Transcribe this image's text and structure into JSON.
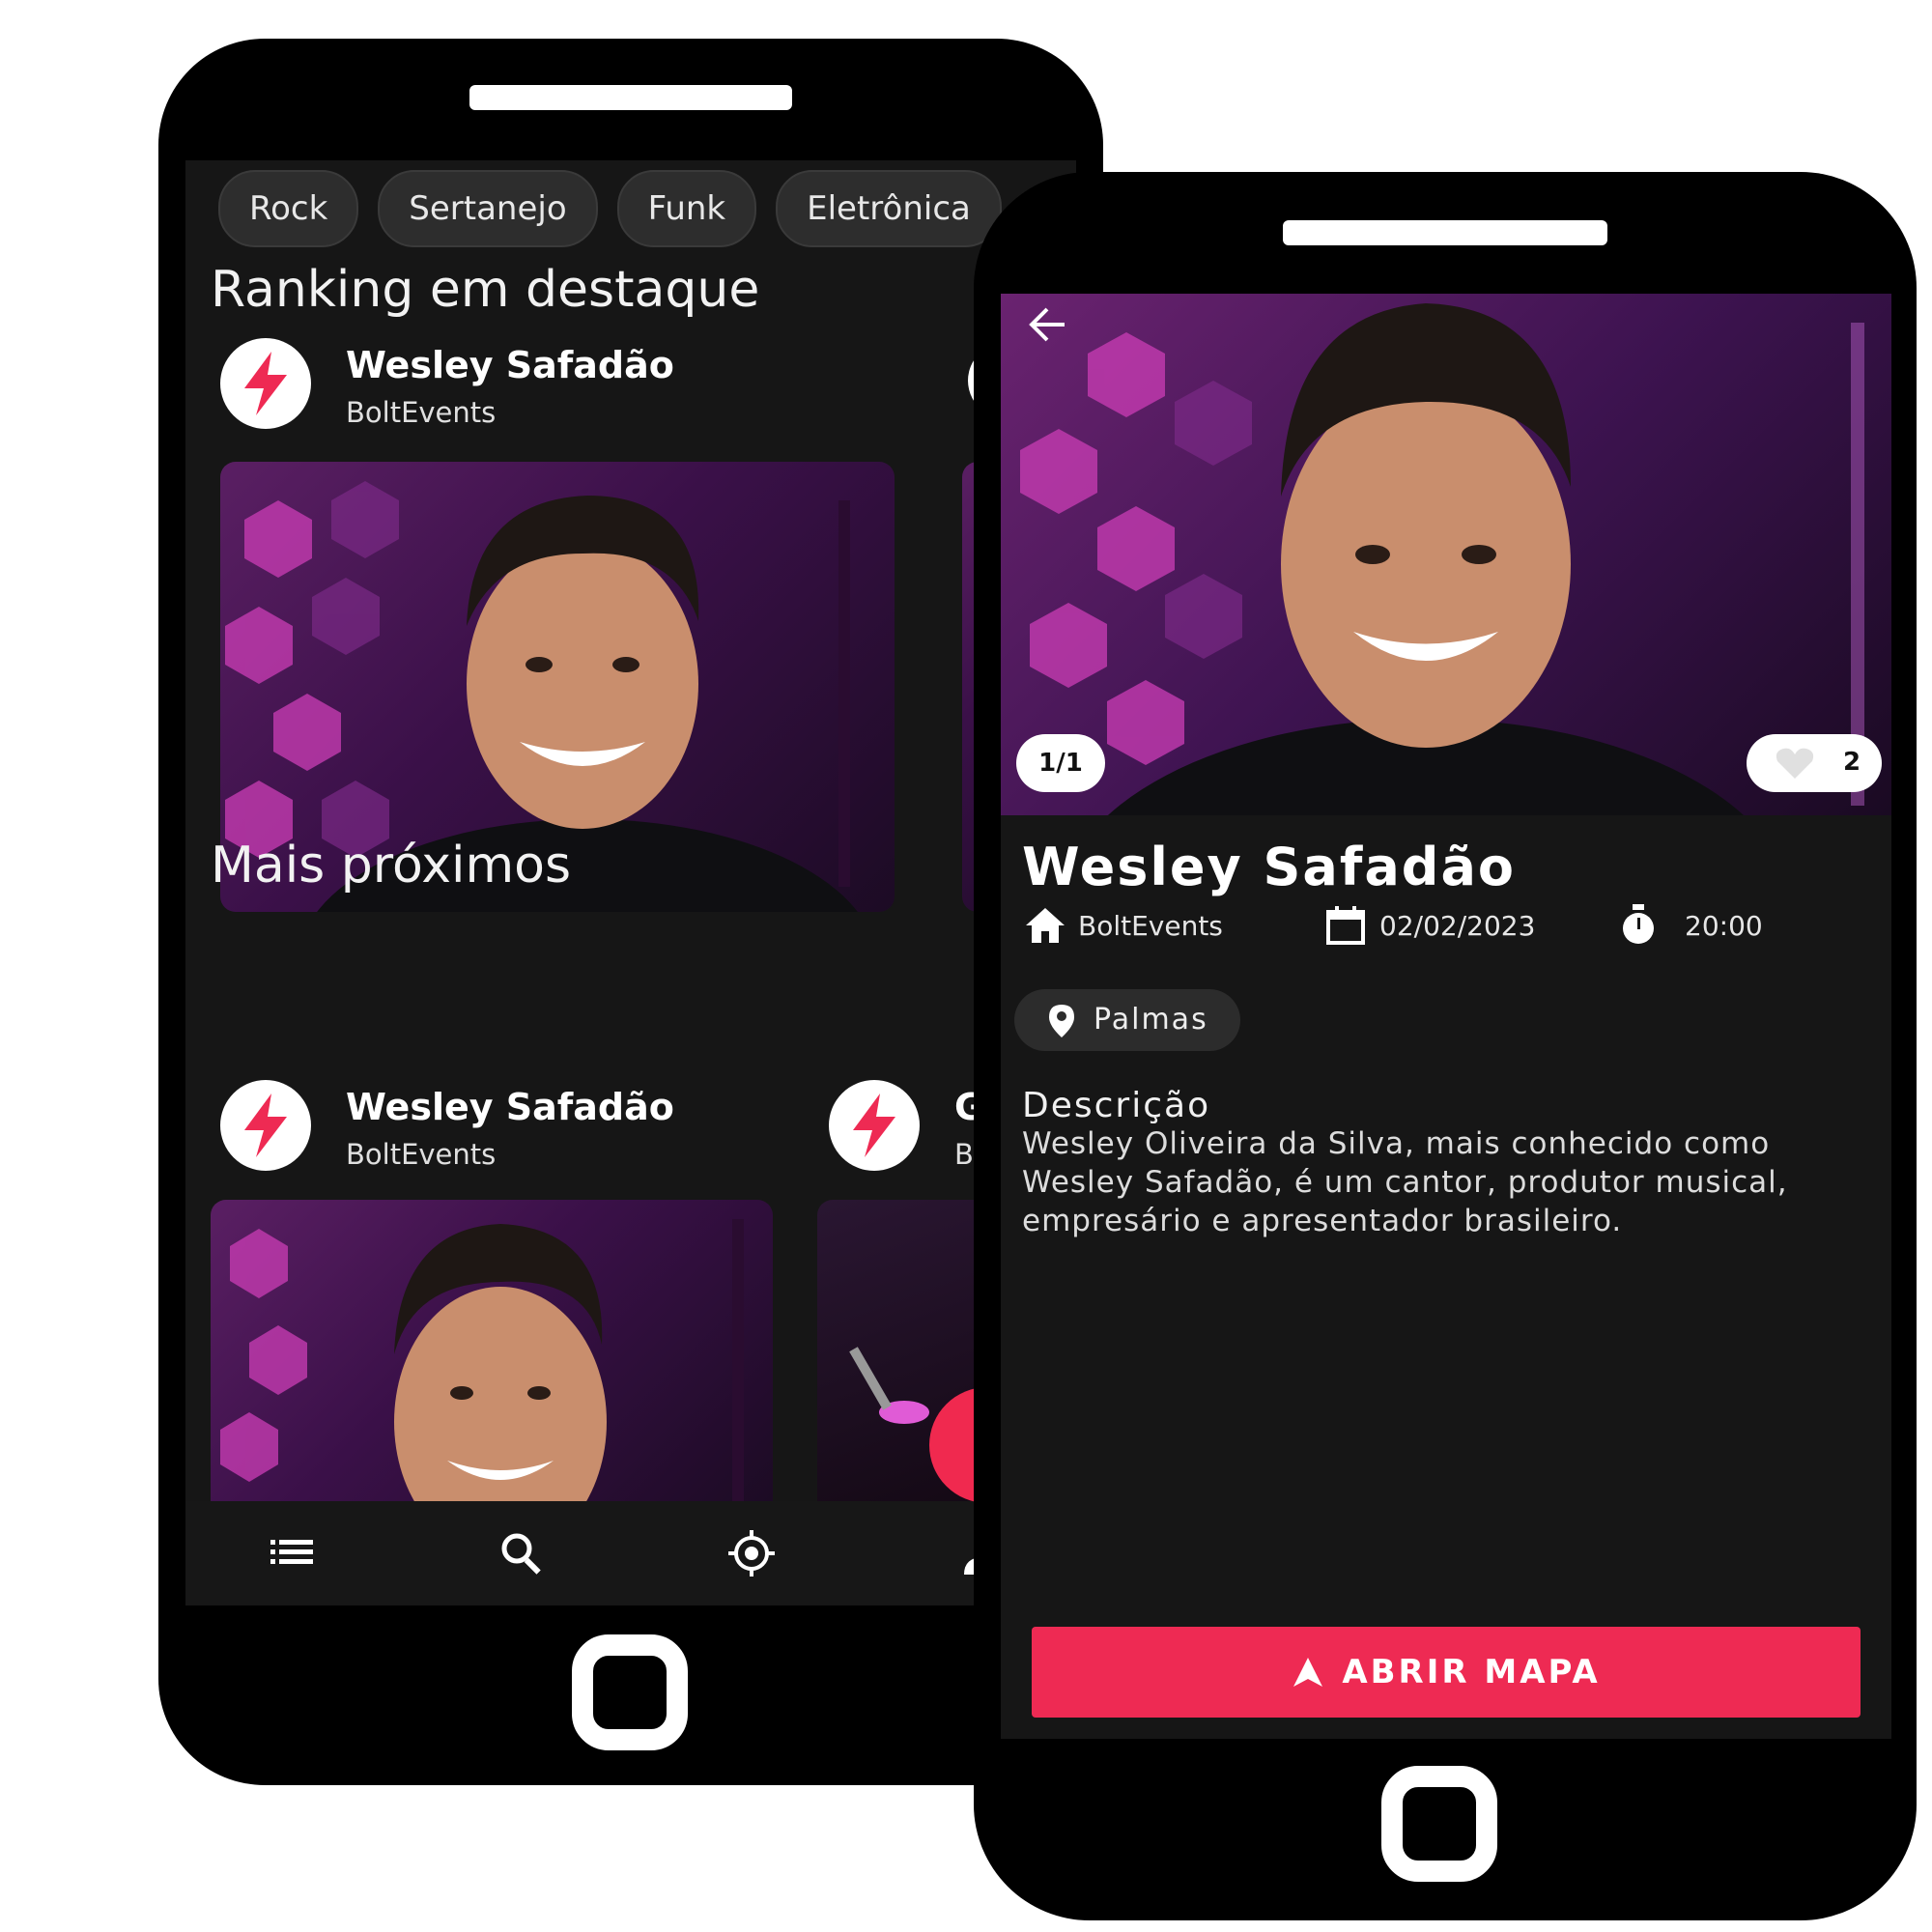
{
  "left_screen": {
    "chips": [
      "Rock",
      "Sertanejo",
      "Funk",
      "Eletrônica"
    ],
    "ranking": {
      "title": "Ranking em destaque",
      "card": {
        "title": "Wesley Safadão",
        "subtitle": "BoltEvents"
      }
    },
    "nearby": {
      "title": "Mais próximos",
      "cards": [
        {
          "title": "Wesley Safadão",
          "subtitle": "BoltEvents"
        },
        {
          "title": "G",
          "subtitle": "B"
        }
      ]
    },
    "bottom_nav": [
      "list-icon",
      "search-icon",
      "location-target-icon",
      "person-icon"
    ]
  },
  "right_screen": {
    "image_counter": "1/1",
    "likes": "2",
    "title": "Wesley Safadão",
    "organizer": "BoltEvents",
    "date": "02/02/2023",
    "time": "20:00",
    "location": "Palmas",
    "description_heading": "Descrição",
    "description": "Wesley Oliveira da Silva, mais conhecido como Wesley Safadão, é um cantor, produtor musical, empresário e apresentador brasileiro.",
    "map_button": "ABRIR MAPA"
  },
  "colors": {
    "accent": "#ee2a53",
    "screen_bg": "#161616",
    "chip_bg": "#2d2d2d"
  }
}
